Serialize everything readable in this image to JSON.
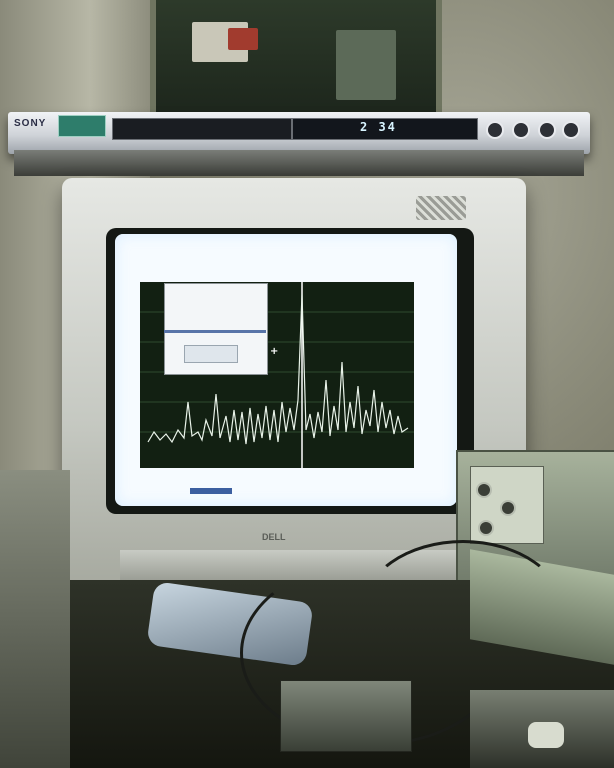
{
  "scene": {
    "description_visible_text": {
      "dvd_brand": "SONY",
      "dvd_readout": "2 34",
      "monitor_logo": "DELL"
    }
  },
  "colors": {
    "screen_background": "#f6fbff",
    "plot_background": "#122012",
    "trace": "#e8f2e8",
    "cursor_line": "#ffffff"
  },
  "icons": [
    "crosshair-icon"
  ]
}
